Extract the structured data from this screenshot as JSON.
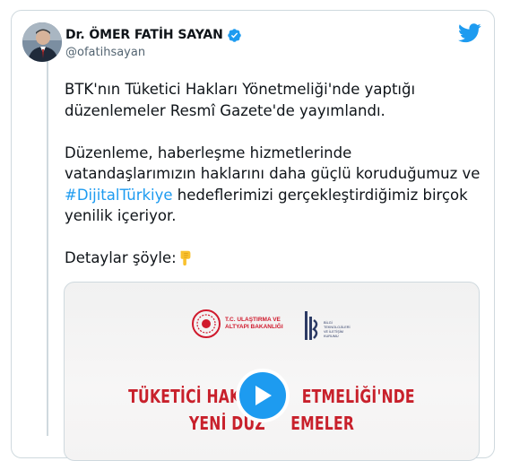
{
  "author": {
    "name": "Dr. ÖMER FATİH SAYAN",
    "handle": "@ofatihsayan",
    "verified": true
  },
  "tweet": {
    "para1": "BTK'nın Tüketici Hakları Yönetmeliği'nde yaptığı düzenlemeler Resmî Gazete'de yayımlandı.",
    "para2_before": "Düzenleme, haberleşme hizmetlerinde vatandaşlarımızın haklarını daha güçlü koruduğumuz ve ",
    "hashtag": "#DijitalTürkiye",
    "para2_after": " hedeflerimizi gerçekleştirdiğimiz birçok yenilik içeriyor.",
    "para3": "Detaylar şöyle:",
    "emoji": "backhand-index-pointing-down"
  },
  "media": {
    "logo_left_line1": "T.C. ULAŞTIRMA VE",
    "logo_left_line2": "ALTYAPI BAKANLIĞI",
    "logo_right_line1": "BİLGİ",
    "logo_right_line2": "TEKNOLOJİLERİ",
    "logo_right_line3": "VE İLETİŞİM",
    "logo_right_line4": "KURUMU",
    "headline_line1": "TÜKETİCİ HAKI           ETMELİĞİ'NDE",
    "headline_line2": "YENİ DÜZ     EMELER"
  },
  "colors": {
    "link": "#1d9bf0",
    "headline_red": "#c8202b",
    "border": "#cfd9de",
    "secondary_text": "#536471"
  },
  "icons": [
    "twitter-bird-icon",
    "verified-badge-icon",
    "play-icon"
  ]
}
